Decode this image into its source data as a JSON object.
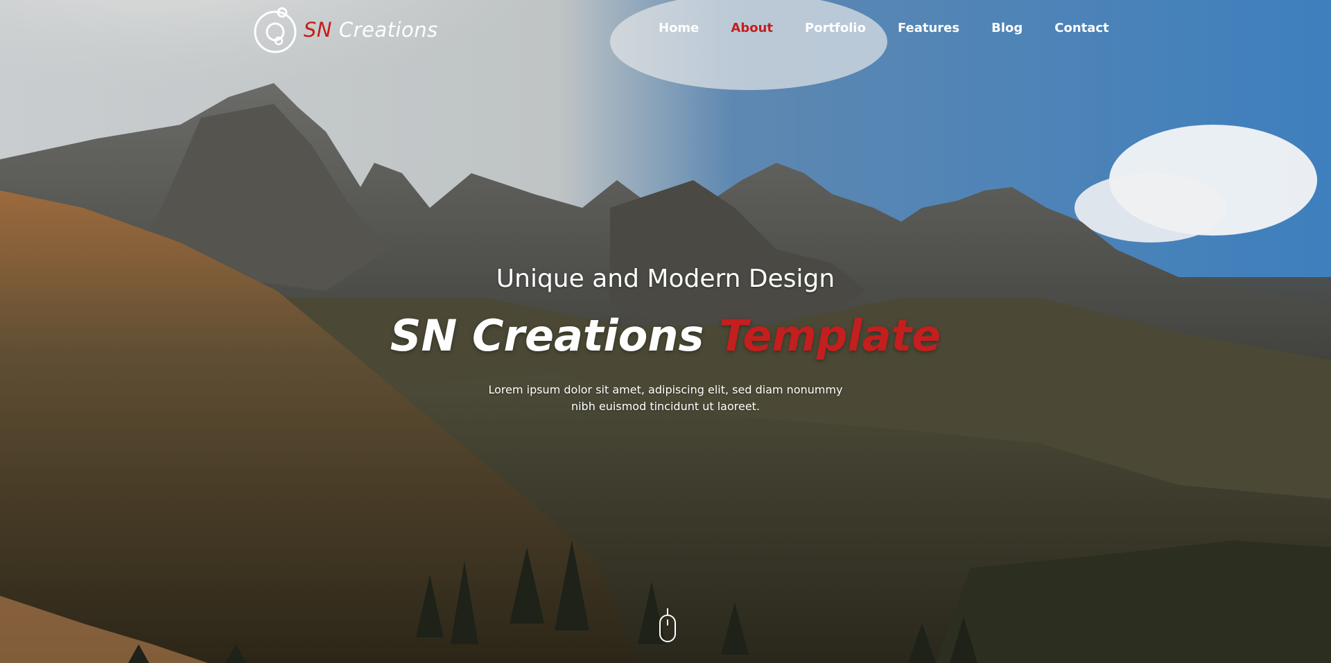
{
  "header": {
    "brand_accent": "SN",
    "brand_rest": "Creations"
  },
  "nav": {
    "items": [
      {
        "label": "Home",
        "active": false
      },
      {
        "label": "About",
        "active": true
      },
      {
        "label": "Portfolio",
        "active": false
      },
      {
        "label": "Features",
        "active": false
      },
      {
        "label": "Blog",
        "active": false
      },
      {
        "label": "Contact",
        "active": false
      }
    ]
  },
  "hero": {
    "subtitle": "Unique and Modern Design",
    "title_main": "SN Creations",
    "title_accent": "Template",
    "description": "Lorem ipsum dolor sit amet, adipiscing elit, sed diam nonummy nibh euismod tincidunt ut laoreet."
  },
  "colors": {
    "accent": "#c41e1e",
    "text": "#ffffff"
  },
  "icons": {
    "logo": "circle-logo-icon",
    "scroll": "mouse-scroll-icon"
  }
}
